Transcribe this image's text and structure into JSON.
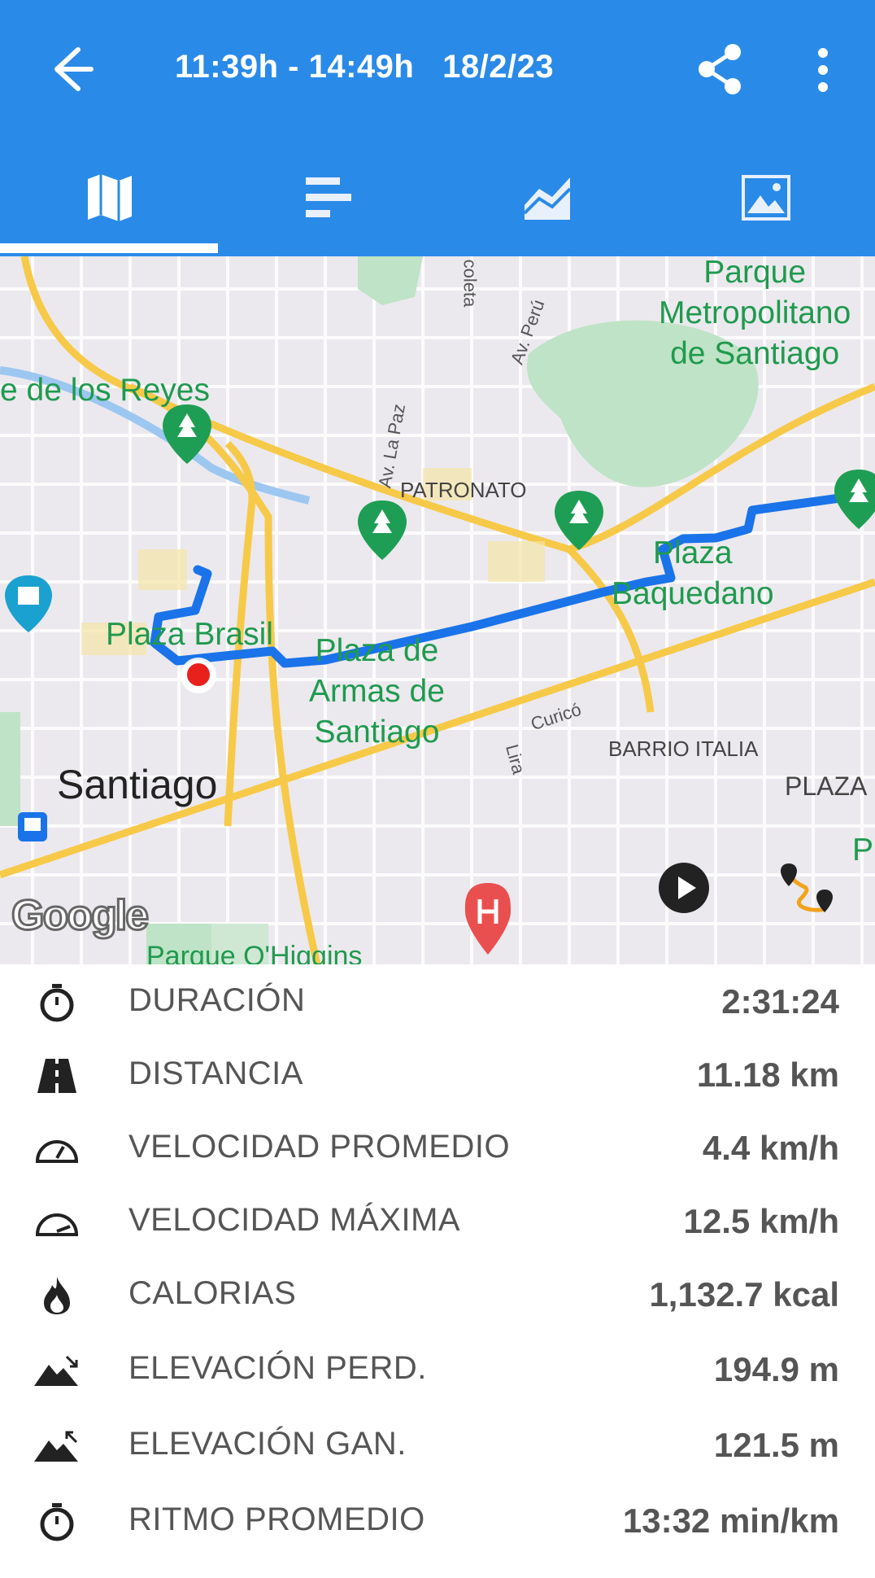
{
  "header": {
    "title": "11:39h - 14:49h   18/2/23",
    "back_icon": "arrow-back-icon",
    "share_icon": "share-icon",
    "more_icon": "more-vert-icon"
  },
  "tabs": [
    {
      "icon": "map-icon",
      "selected": true
    },
    {
      "icon": "bar-list-icon",
      "selected": false
    },
    {
      "icon": "area-chart-icon",
      "selected": false
    },
    {
      "icon": "image-icon",
      "selected": false
    }
  ],
  "map": {
    "labels": {
      "parque_metropolitano": "Parque\nMetropolitano\nde Santiago",
      "reyes": "e de los Reyes",
      "patronato": "PATRONATO",
      "plaza_baquedano": "Plaza\nBaquedano",
      "plaza_brasil": "Plaza Brasil",
      "plaza_armas": "Plaza de\nArmas de\nSantiago",
      "santiago": "Santiago",
      "barrio_italia": "BARRIO ITALIA",
      "plaza_right": "PLAZA",
      "p_right": "P",
      "parque_ohiggins": "Parque O'Higgins",
      "av_la_paz": "Av. La Paz",
      "av_peru": "Av. Perú",
      "recoleta": "coleta",
      "curico": "Curicó",
      "lira": "Lira",
      "google": "Google"
    },
    "route_color": "#1a73e8",
    "play_icon": "play-icon",
    "route_icon": "route-icon"
  },
  "stats": [
    {
      "icon": "stopwatch-icon",
      "label": "DURACIÓN",
      "value": "2:31:24"
    },
    {
      "icon": "road-icon",
      "label": "DISTANCIA",
      "value": "11.18 km"
    },
    {
      "icon": "speedometer-icon",
      "label": "VELOCIDAD PROMEDIO",
      "value": "4.4 km/h"
    },
    {
      "icon": "speedometer-max-icon",
      "label": "VELOCIDAD MÁXIMA",
      "value": "12.5 km/h"
    },
    {
      "icon": "flame-icon",
      "label": "CALORIAS",
      "value": "1,132.7 kcal"
    },
    {
      "icon": "elevation-down-icon",
      "label": "ELEVACIÓN PERD.",
      "value": "194.9 m"
    },
    {
      "icon": "elevation-up-icon",
      "label": "ELEVACIÓN GAN.",
      "value": "121.5 m"
    },
    {
      "icon": "pace-stopwatch-icon",
      "label": "RITMO PROMEDIO",
      "value": "13:32 min/km"
    }
  ]
}
